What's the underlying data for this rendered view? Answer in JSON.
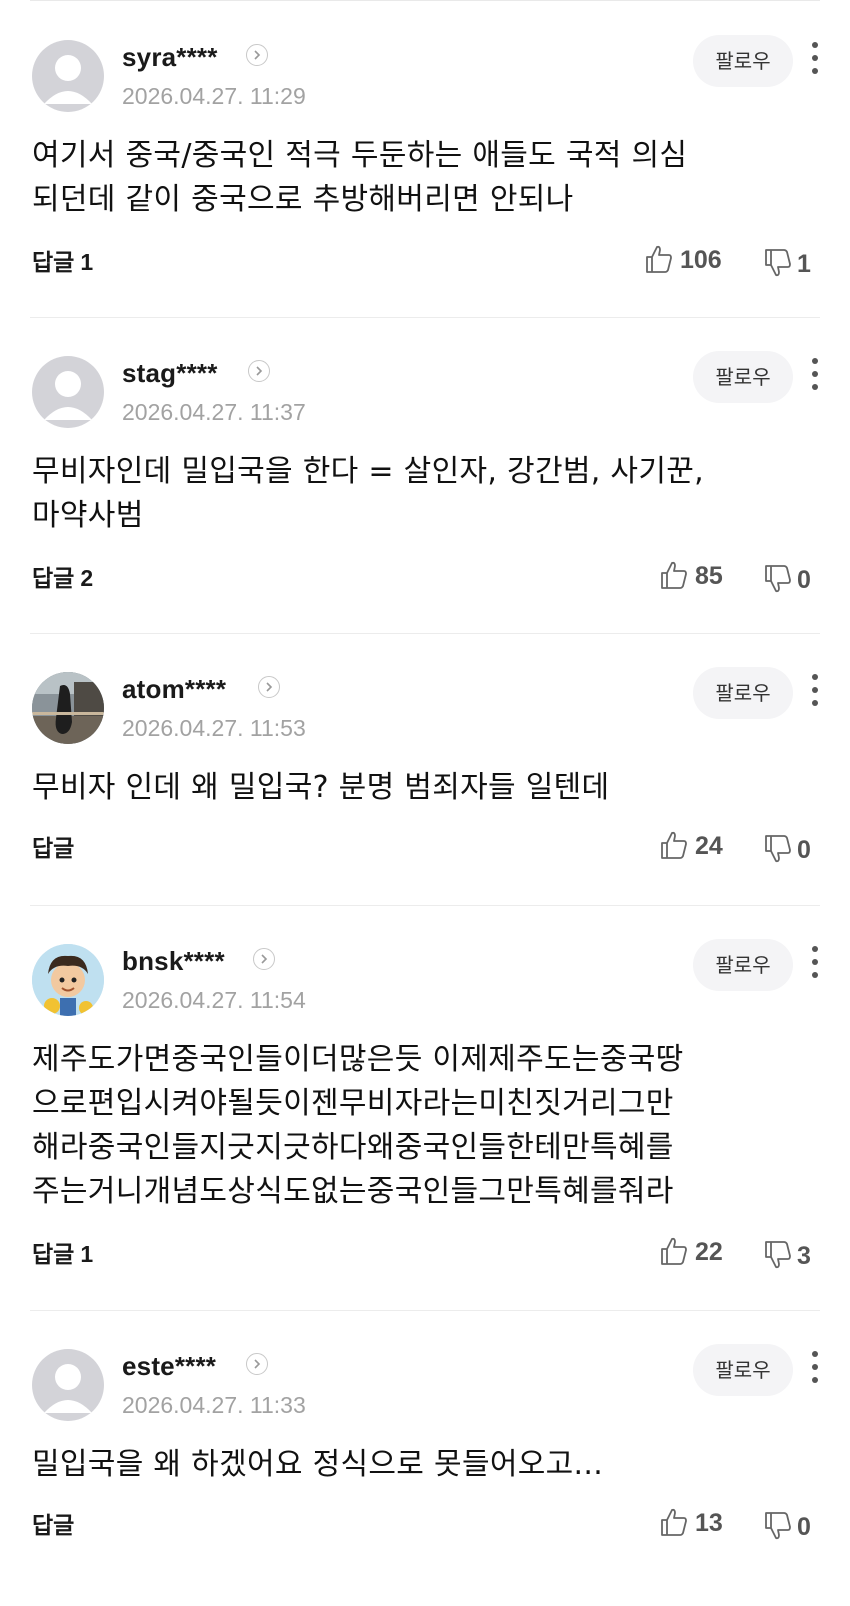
{
  "labels": {
    "follow": "팔로우",
    "reply": "답글"
  },
  "comments": [
    {
      "username": "syra****",
      "time": "2026.04.27. 11:29",
      "text": "여기서 중국/중국인 적극 두둔하는 애들도 국적 의심\n되던데 같이 중국으로 추방해버리면 안되나",
      "reply_count": "1",
      "likes": "106",
      "dislikes": "1",
      "avatar": "default-avatar"
    },
    {
      "username": "stag****",
      "time": "2026.04.27. 11:37",
      "text": "무비자인데 밀입국을 한다 = 살인자, 강간범, 사기꾼,\n마약사범",
      "reply_count": "2",
      "likes": "85",
      "dislikes": "0",
      "avatar": "default-avatar"
    },
    {
      "username": "atom****",
      "time": "2026.04.27. 11:53",
      "text": "무비자 인데 왜 밀입국? 분명 범죄자들 일텐데",
      "reply_count": "",
      "likes": "24",
      "dislikes": "0",
      "avatar": "photo-avatar"
    },
    {
      "username": "bnsk****",
      "time": "2026.04.27. 11:54",
      "text": "제주도가면중국인들이더많은듯 이제제주도는중국땅\n으로편입시켜야될듯이젠무비자라는미친짓거리그만\n해라중국인들지긋지긋하다왜중국인들한테만특혜를\n주는거니개념도상식도없는중국인들그만특혜를줘라",
      "reply_count": "1",
      "likes": "22",
      "dislikes": "3",
      "avatar": "cartoon-avatar"
    },
    {
      "username": "este****",
      "time": "2026.04.27. 11:33",
      "text": "밀입국을 왜 하겠어요 정식으로 못들어오고...",
      "reply_count": "",
      "likes": "13",
      "dislikes": "0",
      "avatar": "default-avatar"
    }
  ]
}
